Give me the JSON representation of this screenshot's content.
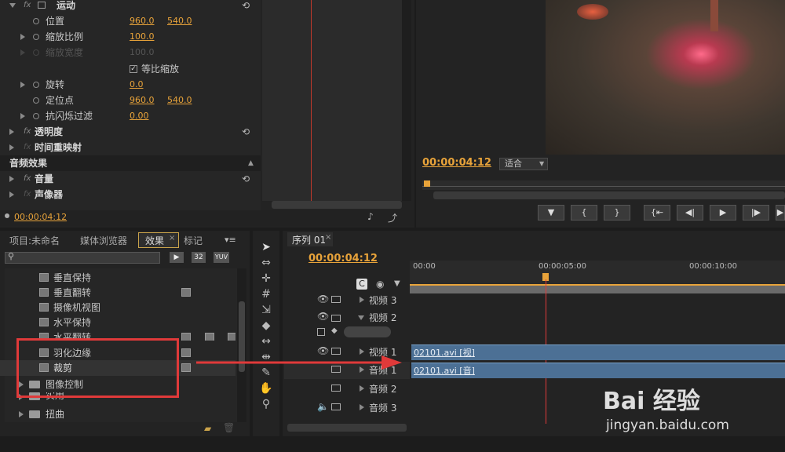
{
  "effect_controls": {
    "motion": "运动",
    "position_label": "位置",
    "position_x": "960.0",
    "position_y": "540.0",
    "scale_label": "缩放比例",
    "scale_value": "100.0",
    "scale_width_label": "缩放宽度",
    "scale_width_value": "100.0",
    "uniform_scale_label": "等比缩放",
    "rotation_label": "旋转",
    "rotation_value": "0.0",
    "anchor_label": "定位点",
    "anchor_x": "960.0",
    "anchor_y": "540.0",
    "flicker_label": "抗闪烁过滤",
    "flicker_value": "0.00",
    "opacity": "透明度",
    "time_remap": "时间重映射",
    "audio_effects": "音频效果",
    "volume": "音量",
    "panner": "声像器",
    "timecode": "00:00:04:12"
  },
  "program_monitor": {
    "timecode": "00:00:04:12",
    "fit_label": "适合"
  },
  "project_panel": {
    "tabs": [
      "项目:未命名",
      "媒体浏览器",
      "效果",
      "标记"
    ],
    "badge_32": "32",
    "badge_yuv": "YUV",
    "items": [
      "垂直保持",
      "垂直翻转",
      "摄像机视图",
      "水平保持",
      "水平翻转",
      "羽化边缘",
      "裁剪"
    ],
    "folders": [
      "图像控制",
      "实用",
      "扭曲"
    ]
  },
  "timeline": {
    "tab": "序列 01",
    "timecode": "00:00:04:12",
    "ruler": [
      "00:00",
      "00:00:05:00",
      "00:00:10:00"
    ],
    "tracks": [
      "视频 3",
      "视频 2",
      "视频 1",
      "音频 1",
      "音频 2",
      "音频 3"
    ],
    "video_clip": "02101.avi [视]",
    "audio_clip": "02101.avi [音]"
  },
  "watermark": {
    "brand_text": "Bai 经验",
    "url": "jingyan.baidu.com"
  },
  "colors": {
    "accent": "#e8a33a",
    "highlight": "#e03a3a",
    "clip": "#4c7095"
  }
}
